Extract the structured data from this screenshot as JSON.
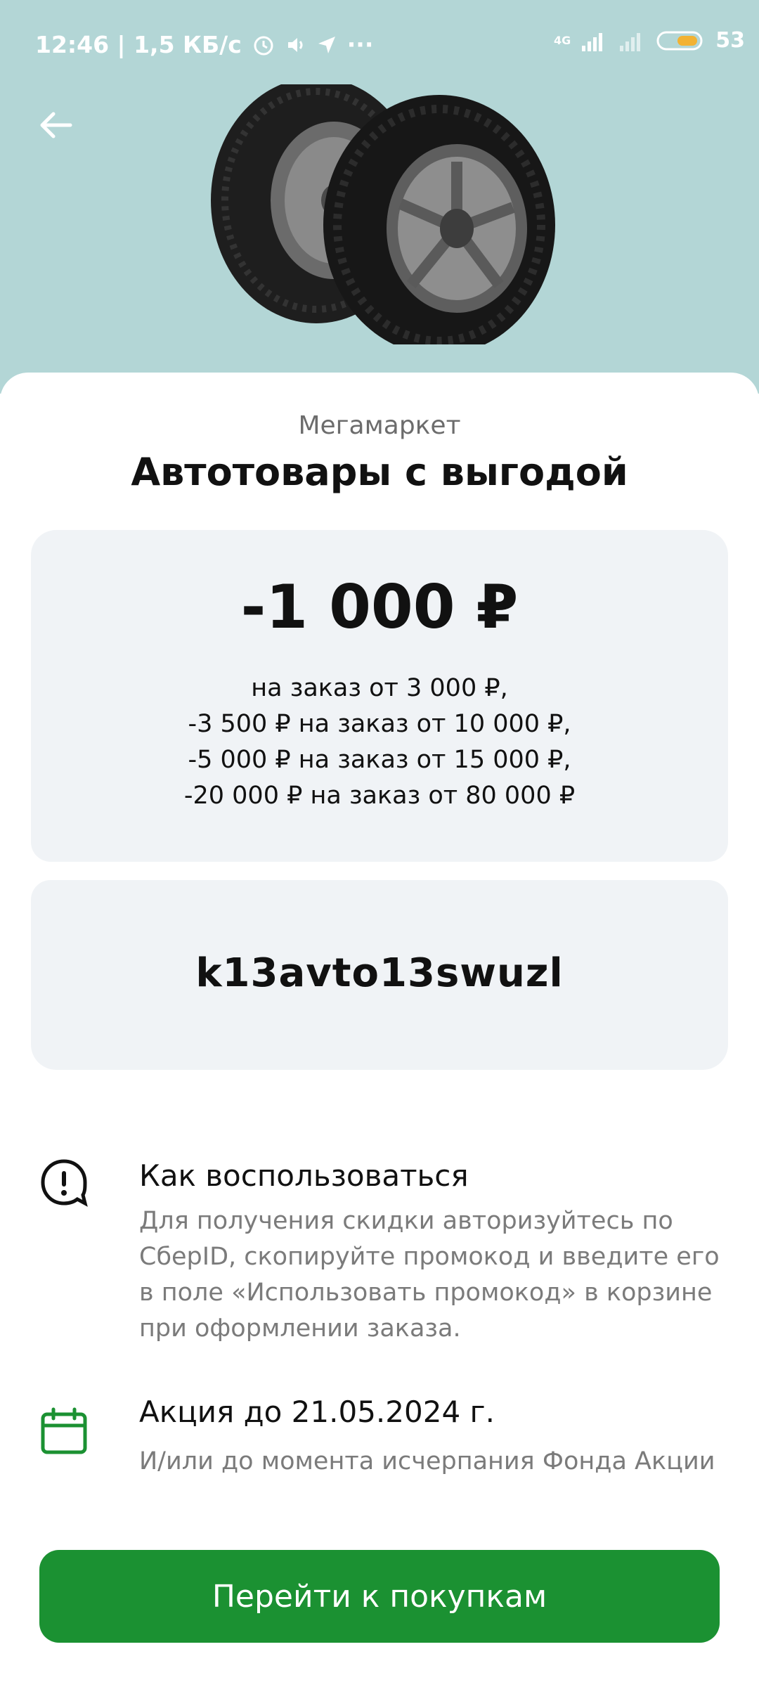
{
  "status_bar": {
    "time_speed": "12:46 | 1,5 КБ/с",
    "more": "···",
    "network": "4G",
    "battery": "53"
  },
  "header": {
    "back_icon": "arrow-left-icon",
    "image": "car-tires-image"
  },
  "offer": {
    "merchant": "Мегамаркет",
    "title": "Автотовары с выгодой",
    "amount": "-1 000 ₽",
    "conditions": [
      "на заказ от 3 000 ₽,",
      "-3 500 ₽ на заказ от 10 000 ₽,",
      "-5 000 ₽ на заказ от 15 000 ₽,",
      "-20 000 ₽ на заказ от 80 000 ₽"
    ],
    "promo_code": "k13avto13swuzl"
  },
  "how_to_use": {
    "icon": "exclamation-speech-icon",
    "title": "Как воспользоваться",
    "text_lines": [
      "Для получения скидки авторизуйтесь по",
      "СберID, скопируйте промокод и введите его",
      "в поле «Использовать промокод» в корзине",
      "при оформлении заказа."
    ]
  },
  "validity": {
    "icon": "calendar-icon",
    "title": "Акция до 21.05.2024 г.",
    "text": "И/или до момента исчерпания Фонда Акции"
  },
  "cta": {
    "label": "Перейти к покупкам",
    "color": "#1b9132"
  },
  "colors": {
    "hero_bg": "#b3d6d6",
    "card_bg": "#f0f3f6",
    "accent_green": "#1b9132"
  }
}
